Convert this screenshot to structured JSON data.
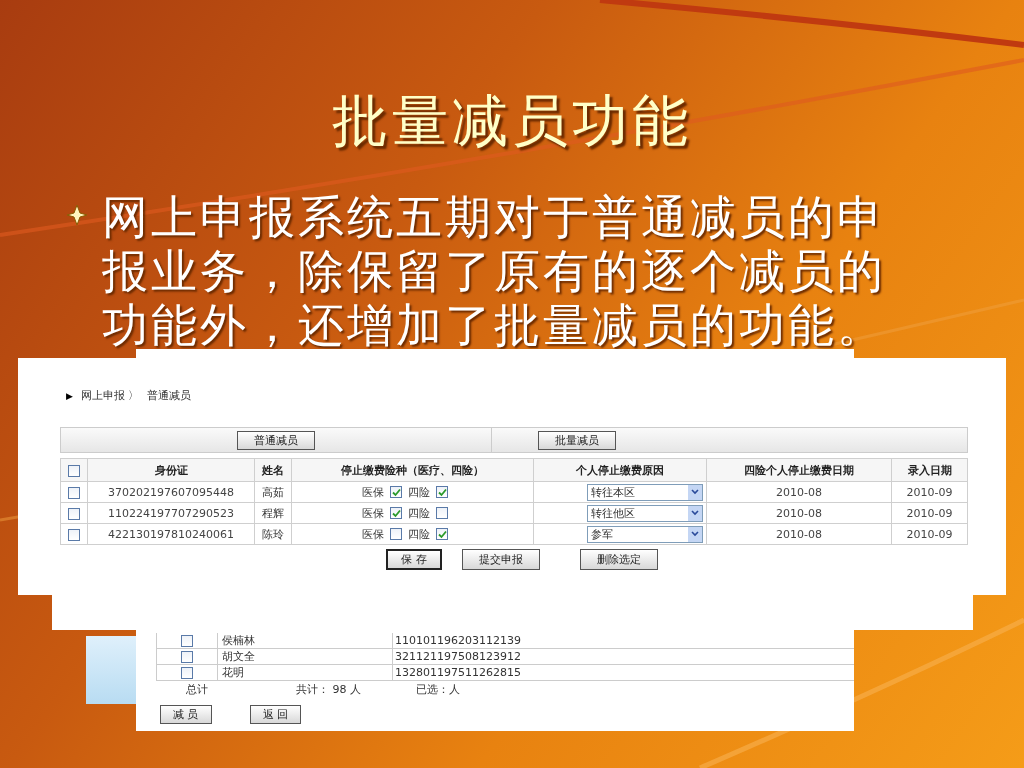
{
  "slide": {
    "title": "批量减员功能",
    "bullet": "网上申报系统五期对于普通减员的申报业务，除保留了原有的逐个减员的功能外，还增加了批量减员的功能。"
  },
  "back_screenshot": {
    "rows": [
      {
        "selected": false,
        "name": "侯楠林",
        "id": "110101196203112139"
      },
      {
        "selected": false,
        "name": "胡文全",
        "id": "321121197508123912"
      },
      {
        "selected": false,
        "name": "花明",
        "id": "132801197511262815"
      }
    ],
    "total_label": "总计",
    "count": "共计： 98 人",
    "selected_count": "已选：人",
    "buttons": [
      "减 员",
      "返 回"
    ]
  },
  "front_screenshot": {
    "breadcrumb_arrow": "▶",
    "breadcrumb": [
      "网上申报 〉",
      "普通减员"
    ],
    "mode_buttons": [
      "普通减员",
      "批量减员"
    ],
    "table": {
      "select_all": false,
      "columns": [
        "身份证",
        "姓名",
        "停止缴费险种（医疗、四险）",
        "个人停止缴费原因",
        "四险个人停止缴费日期",
        "录入日期"
      ],
      "rows": [
        {
          "selected": false,
          "id": "370202197607095448",
          "name": "高茹",
          "medical_label": "医保",
          "medical": true,
          "four_label": "四险",
          "four": true,
          "reason": "转往本区",
          "stop_date": "2010-08",
          "entry_date": "2010-09"
        },
        {
          "selected": false,
          "id": "110224197707290523",
          "name": "程辉",
          "medical_label": "医保",
          "medical": true,
          "four_label": "四险",
          "four": false,
          "reason": "转往他区",
          "stop_date": "2010-08",
          "entry_date": "2010-09"
        },
        {
          "selected": false,
          "id": "422130197810240061",
          "name": "陈玲",
          "medical_label": "医保",
          "medical": false,
          "four_label": "四险",
          "four": true,
          "reason": "参军",
          "stop_date": "2010-08",
          "entry_date": "2010-09"
        }
      ]
    },
    "buttons": [
      "保 存",
      "提交申报",
      "删除选定"
    ]
  }
}
